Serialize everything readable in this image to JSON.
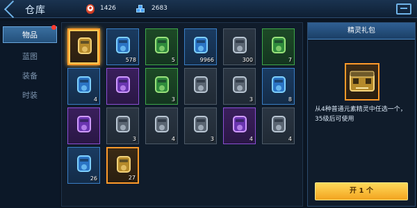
{
  "header": {
    "title": "仓库",
    "resources": [
      {
        "icon": "red-crystal-icon",
        "value": "1426"
      },
      {
        "icon": "blue-cubes-icon",
        "value": "2683"
      }
    ]
  },
  "sidebar": {
    "tabs": [
      {
        "label": "物品",
        "active": true,
        "has_notification": true
      },
      {
        "label": "蓝图",
        "active": false,
        "has_notification": false
      },
      {
        "label": "装备",
        "active": false,
        "has_notification": false
      },
      {
        "label": "时装",
        "active": false,
        "has_notification": false
      }
    ]
  },
  "inventory": {
    "items": [
      {
        "name": "gold-gift-pack-icon",
        "rarity": "orange",
        "count": "",
        "selected": true
      },
      {
        "name": "blue-energy-canister-icon",
        "rarity": "blue",
        "count": "578",
        "selected": false
      },
      {
        "name": "green-energy-canister-icon",
        "rarity": "green",
        "count": "5",
        "selected": false
      },
      {
        "name": "blue-crystal-shard-icon",
        "rarity": "blue",
        "count": "9966",
        "selected": false
      },
      {
        "name": "metal-plate-icon",
        "rarity": "gray",
        "count": "300",
        "selected": false
      },
      {
        "name": "green-module-icon",
        "rarity": "green",
        "count": "7",
        "selected": false
      },
      {
        "name": "blue-armor-part-icon",
        "rarity": "blue",
        "count": "4",
        "selected": false
      },
      {
        "name": "purple-capsule-icon",
        "rarity": "purple",
        "count": "",
        "selected": false
      },
      {
        "name": "green-canister-icon",
        "rarity": "green",
        "count": "3",
        "selected": false
      },
      {
        "name": "gray-claw-part-icon",
        "rarity": "gray",
        "count": "",
        "selected": false
      },
      {
        "name": "gray-ring-part-icon",
        "rarity": "gray",
        "count": "3",
        "selected": false
      },
      {
        "name": "blue-turret-icon",
        "rarity": "blue",
        "count": "8",
        "selected": false
      },
      {
        "name": "purple-engine-icon",
        "rarity": "purple",
        "count": "",
        "selected": false
      },
      {
        "name": "gray-barrel-icon",
        "rarity": "gray",
        "count": "3",
        "selected": false
      },
      {
        "name": "gray-canister-icon",
        "rarity": "gray",
        "count": "4",
        "selected": false
      },
      {
        "name": "gray-gear-part-icon",
        "rarity": "gray",
        "count": "3",
        "selected": false
      },
      {
        "name": "purple-ring-part-icon",
        "rarity": "purple",
        "count": "4",
        "selected": false
      },
      {
        "name": "gray-supply-box-icon",
        "rarity": "gray",
        "count": "4",
        "selected": false
      },
      {
        "name": "blue-cannon-icon",
        "rarity": "blue",
        "count": "26",
        "selected": false
      },
      {
        "name": "orange-cannon-icon",
        "rarity": "orange",
        "count": "27",
        "selected": false
      }
    ]
  },
  "detail": {
    "title": "精灵礼包",
    "icon": "gold-gift-pack-icon",
    "description": "从4种普通元素精灵中任选一个，35级后可使用",
    "button_label": "开 1 个"
  },
  "colors": {
    "accent": "#3a6fa0",
    "orange_rarity": "#ff9a2a",
    "blue_rarity": "#3a7fc6",
    "green_rarity": "#3fa84a",
    "purple_rarity": "#8c4fd4",
    "button": "#f3a41f"
  }
}
